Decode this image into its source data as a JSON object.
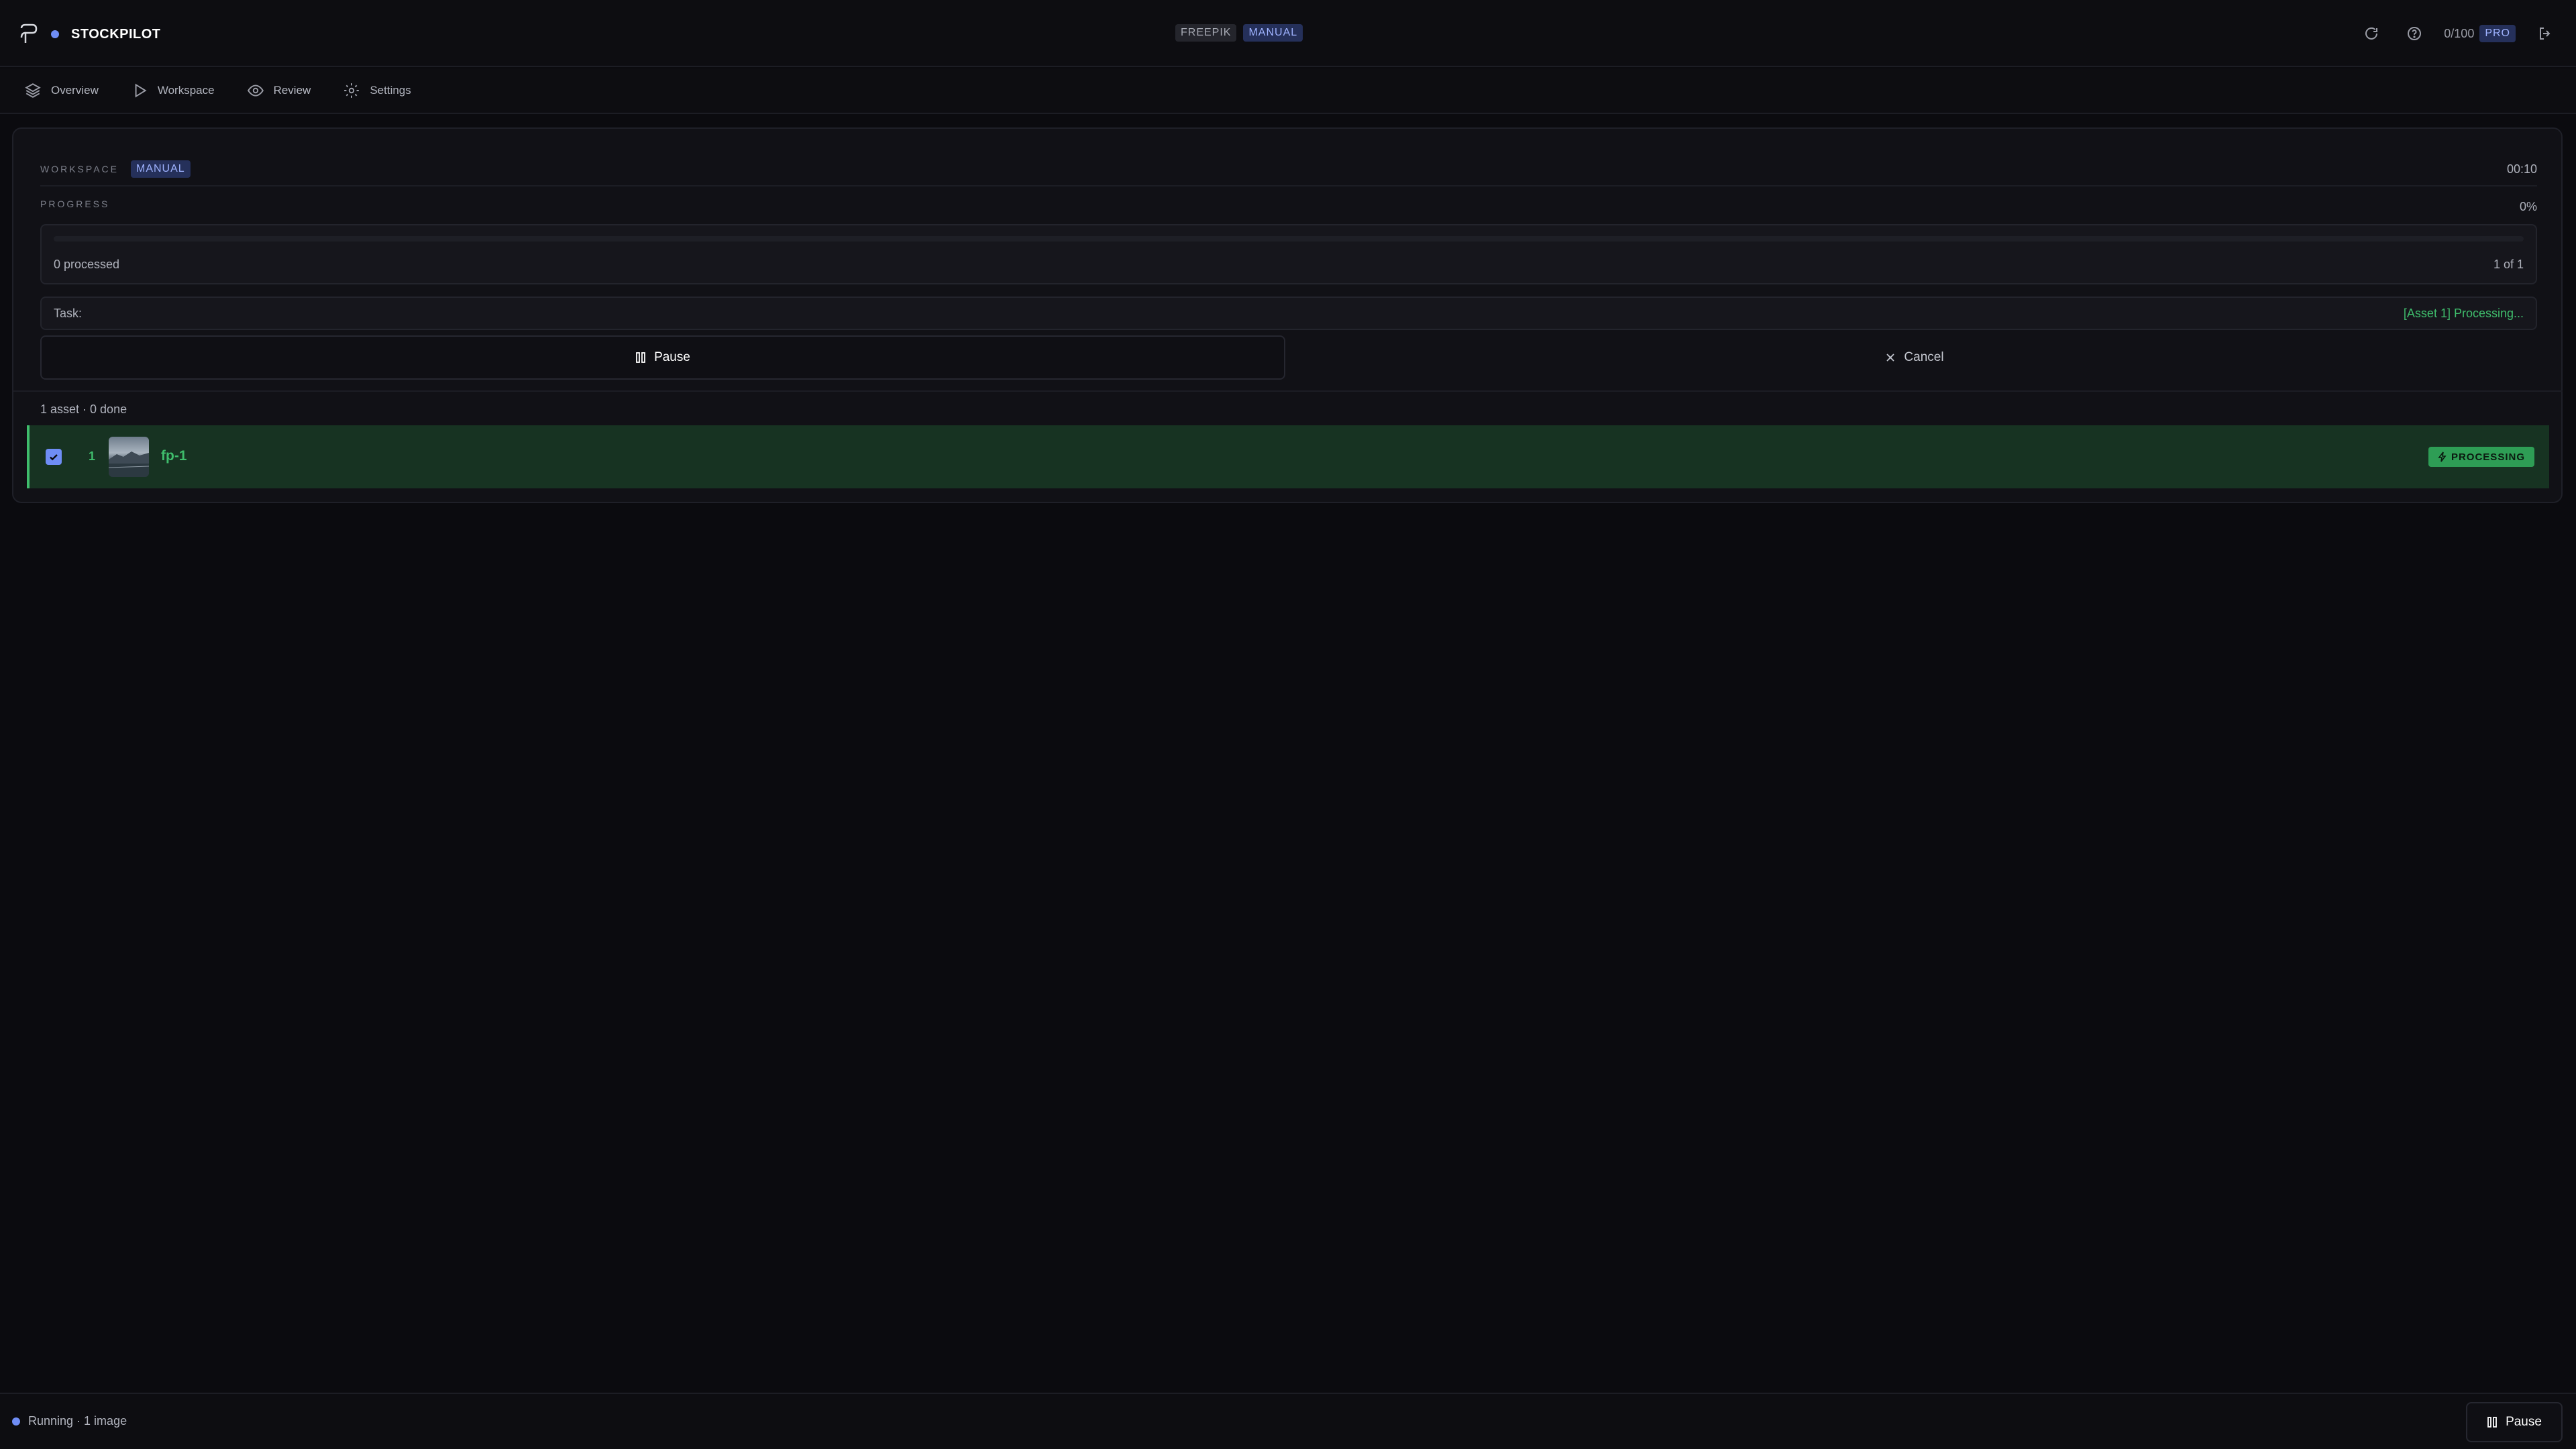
{
  "app": {
    "name": "STOCKPILOT",
    "logo_icon": "stockpilot-logo-icon",
    "accent": "#6f8df5"
  },
  "header": {
    "tags": [
      "FREEPIK",
      "MANUAL"
    ],
    "quota": "0/100",
    "plan": "PRO",
    "icons": [
      "refresh-icon",
      "help-icon",
      "logout-icon"
    ]
  },
  "nav": {
    "items": [
      {
        "label": "Overview",
        "icon": "layers-icon"
      },
      {
        "label": "Workspace",
        "icon": "play-icon"
      },
      {
        "label": "Review",
        "icon": "eye-icon"
      },
      {
        "label": "Settings",
        "icon": "gear-icon"
      }
    ]
  },
  "workspace": {
    "label": "WORKSPACE",
    "mode": "MANUAL",
    "timer": "00:10",
    "progress_label": "PROGRESS",
    "progress_percent": "0%",
    "progress_fraction": 0,
    "processed": "0 processed",
    "count": "1 of 1",
    "task_label": "Task:",
    "task_status": "[Asset 1] Processing...",
    "pause_label": "Pause",
    "cancel_label": "Cancel",
    "summary": "1 asset · 0 done"
  },
  "assets": [
    {
      "index": "1",
      "name": "fp-1",
      "status": "PROCESSING",
      "checked": true,
      "status_color": "#2e9d55"
    }
  ],
  "footer": {
    "status": "Running · 1 image",
    "pause_label": "Pause"
  }
}
